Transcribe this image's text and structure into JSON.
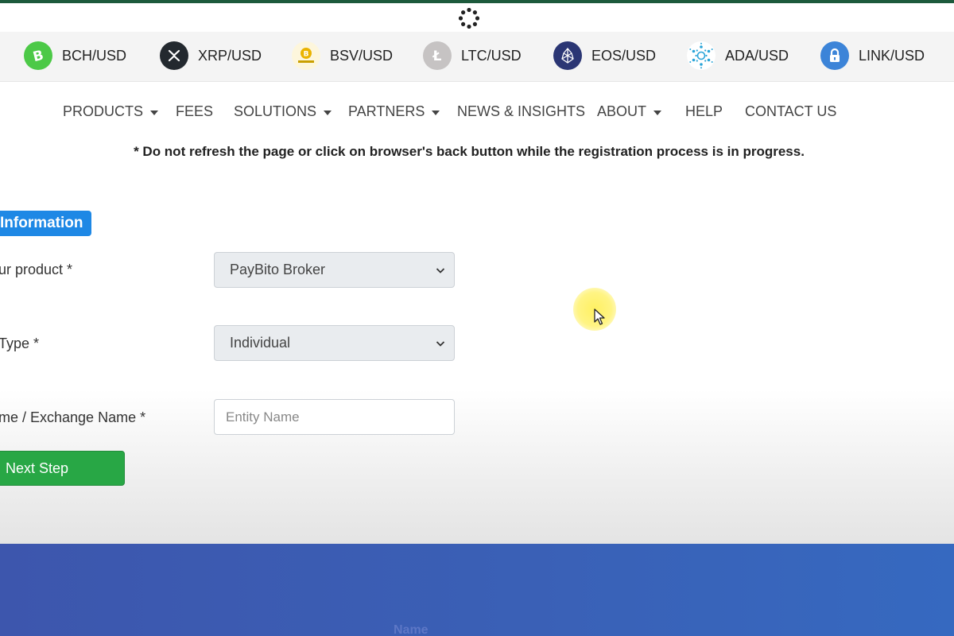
{
  "ticker": [
    {
      "pair": "BCH/USD",
      "icon": "bitcoin-cash-icon",
      "color": "#4cc947"
    },
    {
      "pair": "XRP/USD",
      "icon": "ripple-icon",
      "color": "#23292f"
    },
    {
      "pair": "BSV/USD",
      "icon": "bitcoin-sv-icon",
      "color": "#eab300"
    },
    {
      "pair": "LTC/USD",
      "icon": "litecoin-icon",
      "color": "#bfbbbb"
    },
    {
      "pair": "EOS/USD",
      "icon": "eos-icon",
      "color": "#2b3674"
    },
    {
      "pair": "ADA/USD",
      "icon": "cardano-icon",
      "color": "#2aa4d8"
    },
    {
      "pair": "LINK/USD",
      "icon": "chainlink-icon",
      "color": "#3c84d8"
    }
  ],
  "nav": {
    "products": "PRODUCTS",
    "fees": "FEES",
    "solutions": "SOLUTIONS",
    "partners": "PARTNERS",
    "news": "NEWS & INSIGHTS",
    "about": "ABOUT",
    "help": "HELP",
    "contact": "CONTACT US"
  },
  "notice": "* Do not refresh the page or click on browser's back button while the registration process is in progress.",
  "form": {
    "section_title": "Information",
    "product_label": "ur product *",
    "product_value": "PayBito Broker",
    "type_label": "Type *",
    "type_value": "Individual",
    "name_label": "me / Exchange Name *",
    "name_placeholder": "Entity Name",
    "next_label": "Next Step"
  },
  "footer": {
    "label": "Name"
  },
  "colors": {
    "accent_blue": "#1e88e5",
    "button_green": "#28a745",
    "footer_blue": "#3a60b6"
  }
}
